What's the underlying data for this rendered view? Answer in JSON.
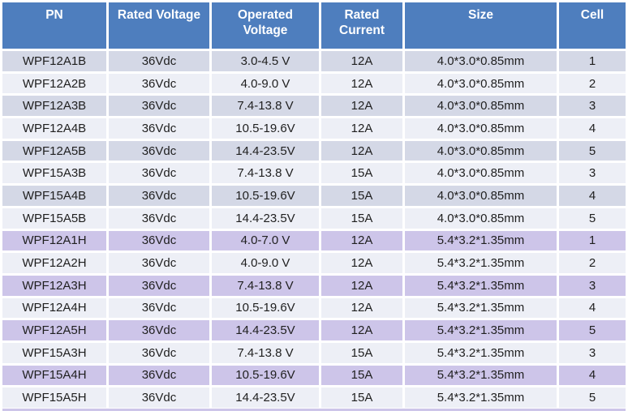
{
  "table": {
    "columns": [
      {
        "id": "pn",
        "label": "PN"
      },
      {
        "id": "rated_voltage",
        "label": "Rated Voltage"
      },
      {
        "id": "operated_voltage",
        "label": "Operated\nVoltage"
      },
      {
        "id": "rated_current",
        "label": "Rated\nCurrent"
      },
      {
        "id": "size",
        "label": "Size"
      },
      {
        "id": "cell",
        "label": "Cell"
      }
    ],
    "rows": [
      {
        "pn": "WPF12A1B",
        "rated_voltage": "36Vdc",
        "operated_voltage": "3.0-4.5 V",
        "rated_current": "12A",
        "size": "4.0*3.0*0.85mm",
        "cell": "1"
      },
      {
        "pn": "WPF12A2B",
        "rated_voltage": "36Vdc",
        "operated_voltage": "4.0-9.0 V",
        "rated_current": "12A",
        "size": "4.0*3.0*0.85mm",
        "cell": "2"
      },
      {
        "pn": "WPF12A3B",
        "rated_voltage": "36Vdc",
        "operated_voltage": "7.4-13.8 V",
        "rated_current": "12A",
        "size": "4.0*3.0*0.85mm",
        "cell": "3"
      },
      {
        "pn": "WPF12A4B",
        "rated_voltage": "36Vdc",
        "operated_voltage": "10.5-19.6V",
        "rated_current": "12A",
        "size": "4.0*3.0*0.85mm",
        "cell": "4"
      },
      {
        "pn": "WPF12A5B",
        "rated_voltage": "36Vdc",
        "operated_voltage": "14.4-23.5V",
        "rated_current": "12A",
        "size": "4.0*3.0*0.85mm",
        "cell": "5"
      },
      {
        "pn": "WPF15A3B",
        "rated_voltage": "36Vdc",
        "operated_voltage": "7.4-13.8 V",
        "rated_current": "15A",
        "size": "4.0*3.0*0.85mm",
        "cell": "3"
      },
      {
        "pn": "WPF15A4B",
        "rated_voltage": "36Vdc",
        "operated_voltage": "10.5-19.6V",
        "rated_current": "15A",
        "size": "4.0*3.0*0.85mm",
        "cell": "4"
      },
      {
        "pn": "WPF15A5B",
        "rated_voltage": "36Vdc",
        "operated_voltage": "14.4-23.5V",
        "rated_current": "15A",
        "size": "4.0*3.0*0.85mm",
        "cell": "5"
      },
      {
        "pn": "WPF12A1H",
        "rated_voltage": "36Vdc",
        "operated_voltage": "4.0-7.0 V",
        "rated_current": "12A",
        "size": "5.4*3.2*1.35mm",
        "cell": "1"
      },
      {
        "pn": "WPF12A2H",
        "rated_voltage": "36Vdc",
        "operated_voltage": "4.0-9.0 V",
        "rated_current": "12A",
        "size": "5.4*3.2*1.35mm",
        "cell": "2"
      },
      {
        "pn": "WPF12A3H",
        "rated_voltage": "36Vdc",
        "operated_voltage": "7.4-13.8 V",
        "rated_current": "12A",
        "size": "5.4*3.2*1.35mm",
        "cell": "3"
      },
      {
        "pn": "WPF12A4H",
        "rated_voltage": "36Vdc",
        "operated_voltage": "10.5-19.6V",
        "rated_current": "12A",
        "size": "5.4*3.2*1.35mm",
        "cell": "4"
      },
      {
        "pn": "WPF12A5H",
        "rated_voltage": "36Vdc",
        "operated_voltage": "14.4-23.5V",
        "rated_current": "12A",
        "size": "5.4*3.2*1.35mm",
        "cell": "5"
      },
      {
        "pn": "WPF15A3H",
        "rated_voltage": "36Vdc",
        "operated_voltage": "7.4-13.8 V",
        "rated_current": "15A",
        "size": "5.4*3.2*1.35mm",
        "cell": "3"
      },
      {
        "pn": "WPF15A4H",
        "rated_voltage": "36Vdc",
        "operated_voltage": "10.5-19.6V",
        "rated_current": "15A",
        "size": "5.4*3.2*1.35mm",
        "cell": "4"
      },
      {
        "pn": "WPF15A5H",
        "rated_voltage": "36Vdc",
        "operated_voltage": "14.4-23.5V",
        "rated_current": "15A",
        "size": "5.4*3.2*1.35mm",
        "cell": "5"
      }
    ]
  },
  "colors": {
    "header_bg": "#4E7EBE",
    "header_text": "#FFFFFF",
    "band_blue": "#D4D8E6",
    "band_purple": "#CDC5E9",
    "band_light": "#EDEFF6",
    "separator": "#FFFFFF",
    "body_text": "#1F1F1F"
  }
}
